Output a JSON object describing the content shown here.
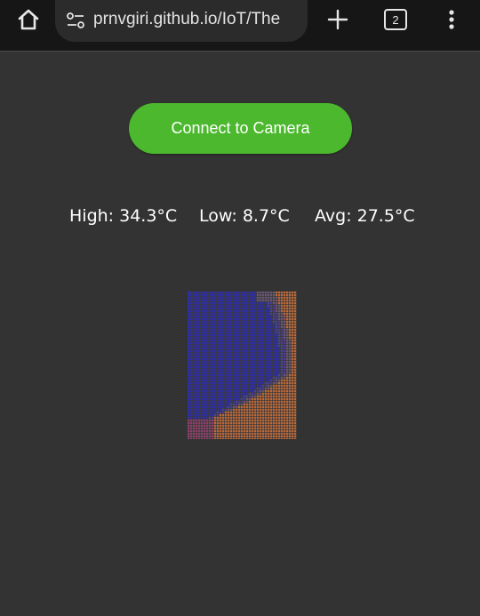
{
  "browser": {
    "url": "prnvgiri.github.io/IoT/The",
    "tab_count": "2",
    "icons": [
      "home-icon",
      "site-settings-icon",
      "plus-icon",
      "tab-switcher-icon",
      "more-vert-icon"
    ]
  },
  "main": {
    "connect_label": "Connect to Camera",
    "stats": {
      "high": "High: 34.3°C",
      "low": "Low: 8.7°C",
      "avg": "Avg: 27.5°C"
    }
  },
  "colors": {
    "background": "#333333",
    "button_green": "#4cb82e",
    "thermal_cold": "#2a2ad0",
    "thermal_mid": "#7a5090",
    "thermal_hot": "#e4783a"
  }
}
